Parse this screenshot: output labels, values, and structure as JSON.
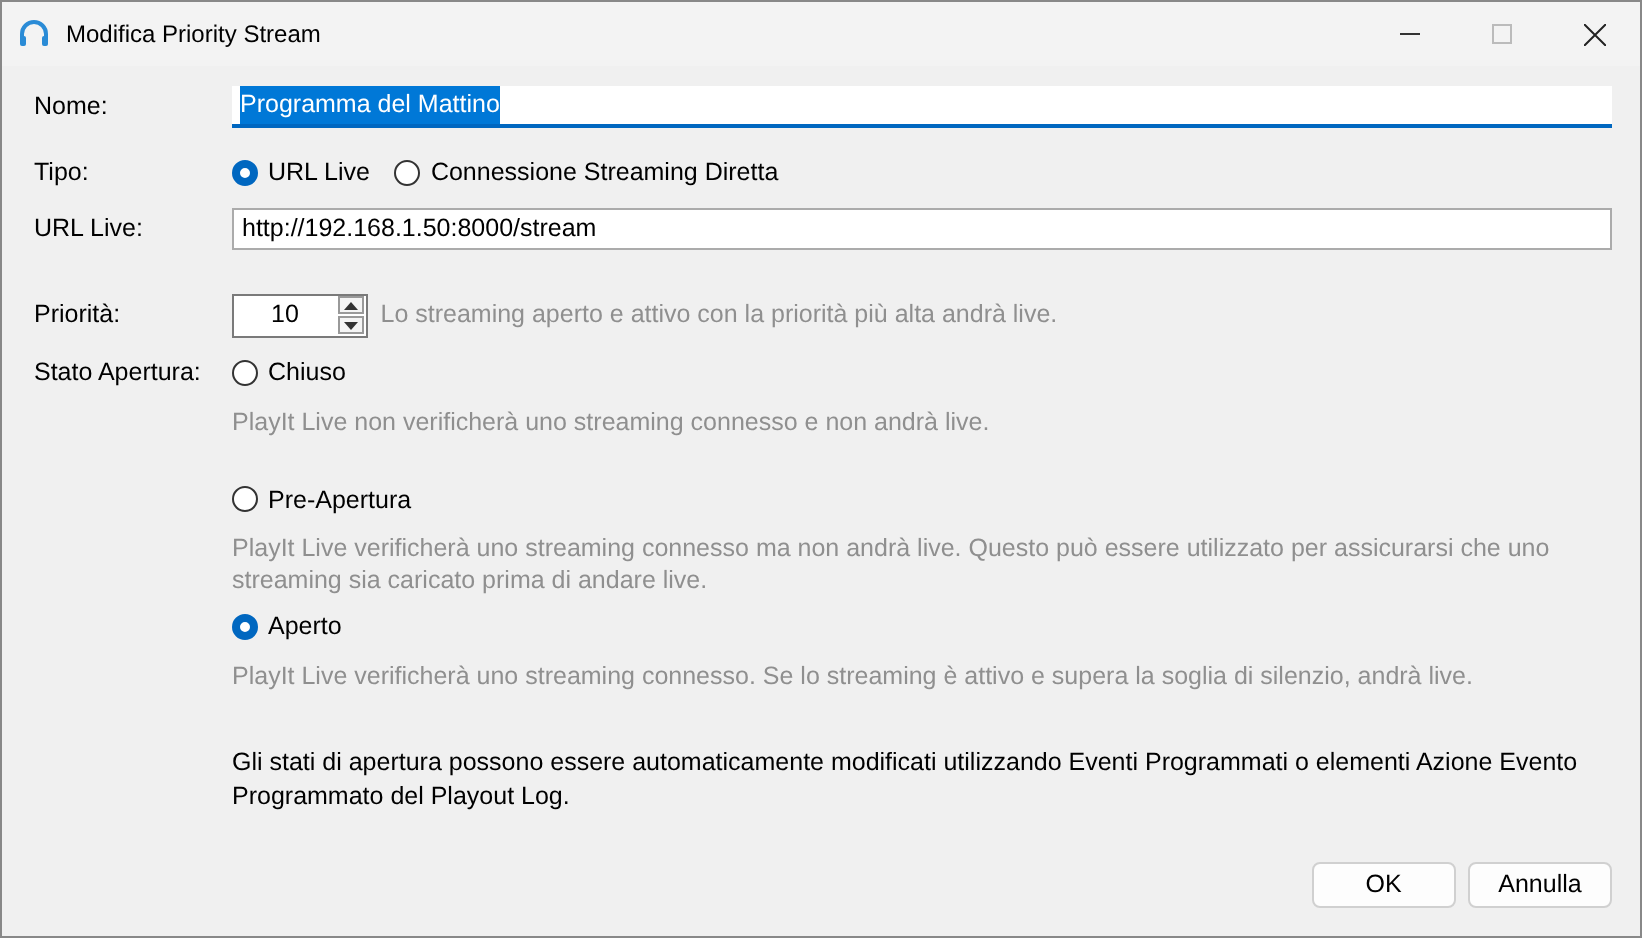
{
  "window": {
    "title": "Modifica Priority Stream"
  },
  "name_field": {
    "label": "Nome:",
    "value": "Programma del Mattino",
    "text_selected": true
  },
  "type": {
    "label": "Tipo:",
    "options": [
      {
        "label": "URL Live",
        "selected": true
      },
      {
        "label": "Connessione Streaming Diretta",
        "selected": false
      }
    ]
  },
  "url_field": {
    "label": "URL Live:",
    "value": "http://192.168.1.50:8000/stream"
  },
  "priority": {
    "label": "Priorità:",
    "value": "10",
    "hint": "Lo streaming aperto e attivo con la priorità più alta andrà live."
  },
  "open_state": {
    "label": "Stato Apertura:",
    "options": [
      {
        "label": "Chiuso",
        "selected": false,
        "description": "PlayIt Live non verificherà uno streaming connesso e non andrà live."
      },
      {
        "label": "Pre-Apertura",
        "selected": false,
        "description": "PlayIt Live verificherà uno streaming connesso ma non andrà live. Questo può essere utilizzato per assicurarsi che uno streaming sia caricato prima di andare live."
      },
      {
        "label": "Aperto",
        "selected": true,
        "description": "PlayIt Live verificherà uno streaming connesso. Se lo streaming è attivo e supera la soglia di silenzio, andrà live."
      }
    ]
  },
  "note": "Gli stati di apertura possono essere automaticamente modificati utilizzando Eventi Programmati o elementi Azione Evento Programmato del Playout Log.",
  "buttons": [
    "OK",
    "Annulla"
  ]
}
